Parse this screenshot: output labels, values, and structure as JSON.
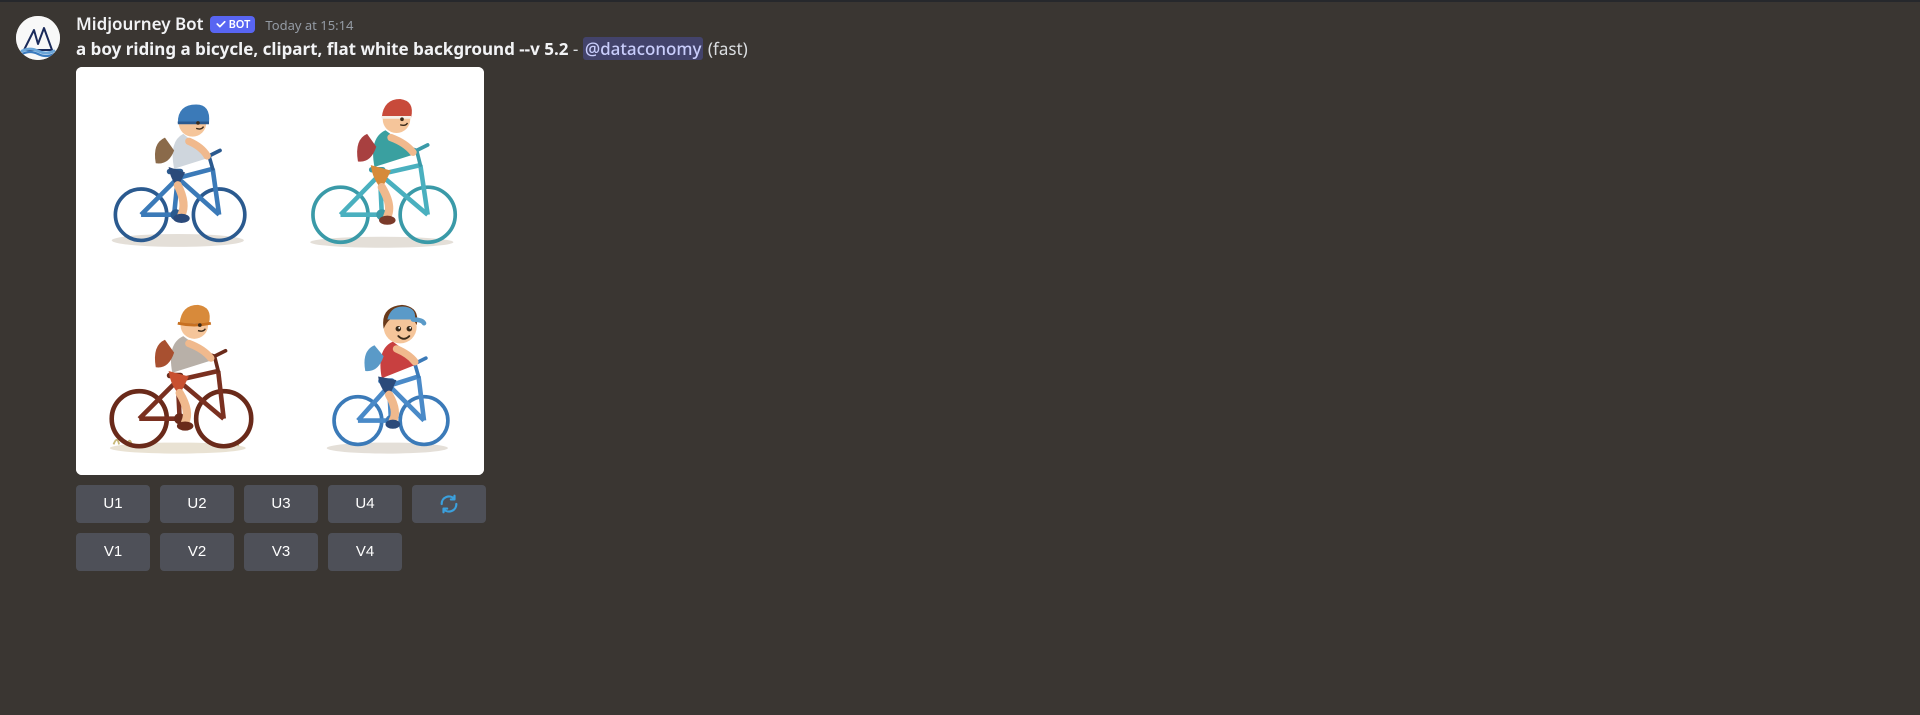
{
  "message": {
    "author": "Midjourney Bot",
    "bot_label": "BOT",
    "timestamp": "Today at 15:14",
    "prompt_text": "a boy riding a bicycle, clipart, flat white background --v 5.2",
    "separator": " - ",
    "mention": "@dataconomy",
    "suffix": " (fast)"
  },
  "buttons": {
    "upscale": [
      "U1",
      "U2",
      "U3",
      "U4"
    ],
    "refresh_icon": "refresh",
    "variations": [
      "V1",
      "V2",
      "V3",
      "V4"
    ]
  }
}
